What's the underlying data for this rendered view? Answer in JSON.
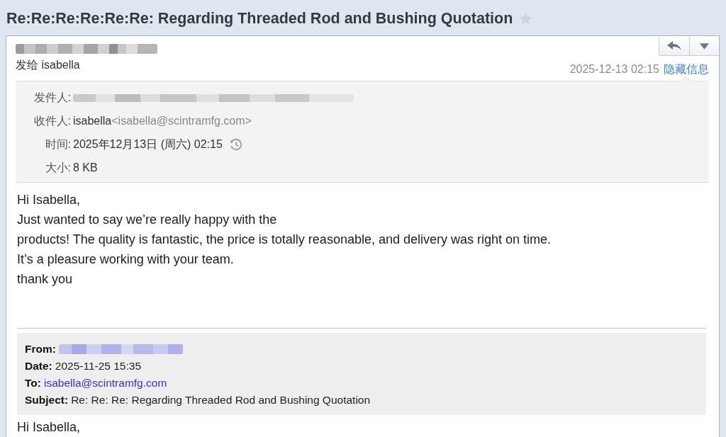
{
  "title": "Re:Re:Re:Re:Re:Re: Regarding Threaded Rod and Bushing Quotation",
  "starred": false,
  "header": {
    "sent_to": "发给 isabella",
    "date": "2025-12-13 02:15",
    "toggle_link": "隐藏信息",
    "details_expanded": true
  },
  "details": [
    {
      "kind": "redacted",
      "label": "发件人:"
    },
    {
      "kind": "contact",
      "label": "收件人:",
      "name": "isabella",
      "address": "<isabella@scintramfg.com>"
    },
    {
      "kind": "time",
      "label": "时间:",
      "value": "2025年12月13日 (周六) 02:15"
    },
    {
      "kind": "text",
      "label": "大小:",
      "value": "8 KB"
    }
  ],
  "body": [
    "Hi Isabella,",
    "Just wanted to say we’re really happy with the",
    "products! The quality is fantastic, the price is totally reasonable, and delivery was right on time.",
    "It’s a pleasure working with your team.",
    "thank you"
  ],
  "quoted": {
    "fields": [
      {
        "kind": "redacted",
        "label": "From:"
      },
      {
        "kind": "text",
        "label": "Date:",
        "value": "2025-11-25 15:35"
      },
      {
        "kind": "link",
        "label": "To:",
        "value": "isabella@scintramfg.com"
      },
      {
        "kind": "text",
        "label": "Subject:",
        "value": "Re: Re: Re: Regarding Threaded Rod and Bushing Quotation"
      }
    ],
    "body": [
      "Hi Isabella,"
    ]
  }
}
